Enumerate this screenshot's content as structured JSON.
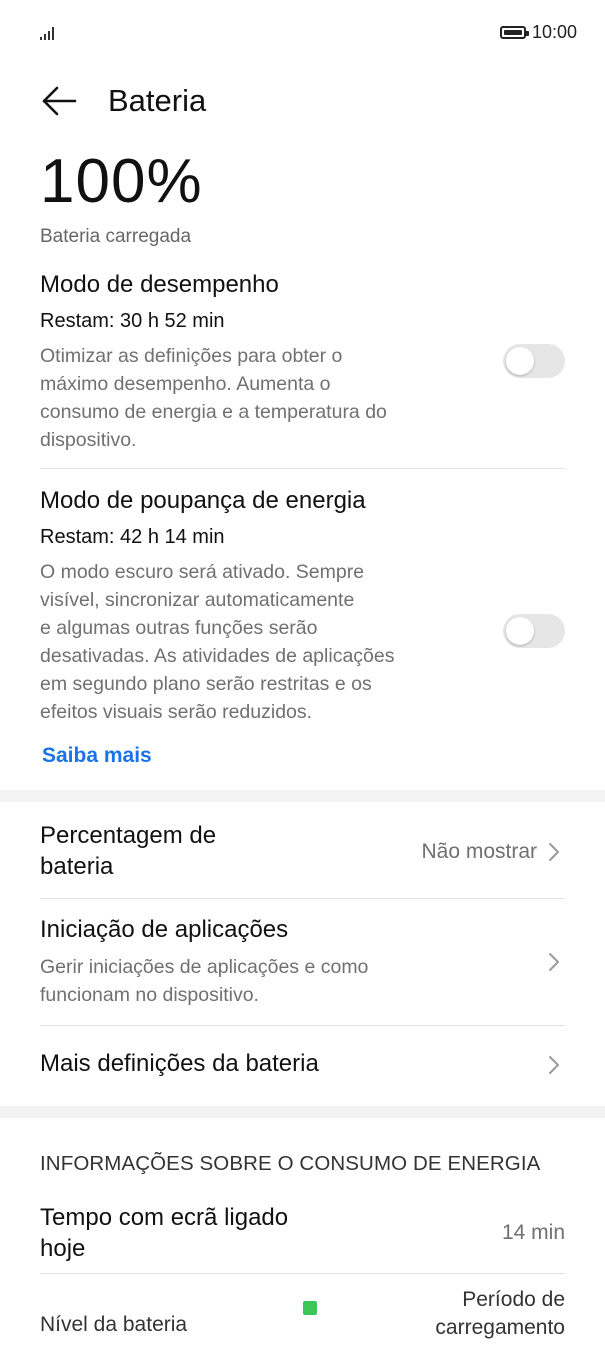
{
  "status_bar": {
    "time": "10:00",
    "signal_icon": "signal-bars-icon",
    "battery_icon": "battery-full-icon"
  },
  "header": {
    "title": "Bateria",
    "back_icon": "arrow-left-icon"
  },
  "battery": {
    "percent": "100%",
    "status": "Bateria carregada",
    "level_fraction": 1.0
  },
  "performance_mode": {
    "title": "Modo de desempenho",
    "remaining": "Restam: 30 h 52 min",
    "description": [
      "Otimizar as definições para obter o",
      "máximo desempenho. Aumenta o",
      "consumo de energia e a temperatura do",
      "dispositivo."
    ],
    "enabled": false
  },
  "power_saving_mode": {
    "title": "Modo de poupança de energia",
    "remaining": "Restam: 42 h 14 min",
    "description": [
      "O modo escuro será ativado. Sempre",
      "visível, sincronizar automaticamente",
      "e algumas outras funções serão",
      "desativadas. As atividades de aplicações",
      "em segundo plano serão restritas e os",
      "efeitos visuais serão reduzidos."
    ],
    "enabled": false,
    "learn_more": "Saiba mais"
  },
  "settings": {
    "battery_percentage": {
      "label_lines": [
        "Percentagem de",
        "bateria"
      ],
      "value": "Não mostrar"
    },
    "app_launch": {
      "label": "Iniciação de aplicações",
      "description": [
        "Gerir iniciações de aplicações e como",
        "funcionam no dispositivo."
      ]
    },
    "more_settings": {
      "label": "Mais definições da bateria"
    }
  },
  "consumption": {
    "header": "INFORMAÇÕES SOBRE O CONSUMO DE ENERGIA",
    "screen_time_label": [
      "Tempo com ecrã ligado",
      "hoje"
    ],
    "screen_time_value": "14 min",
    "battery_level_label": "Nível da bateria",
    "charging_period_label": [
      "Período de",
      "carregamento"
    ],
    "accent": "#3cc65a"
  },
  "colors": {
    "link": "#1a73e8",
    "toggle_off": "#e6e6e6",
    "secondary_text": "#707070"
  }
}
